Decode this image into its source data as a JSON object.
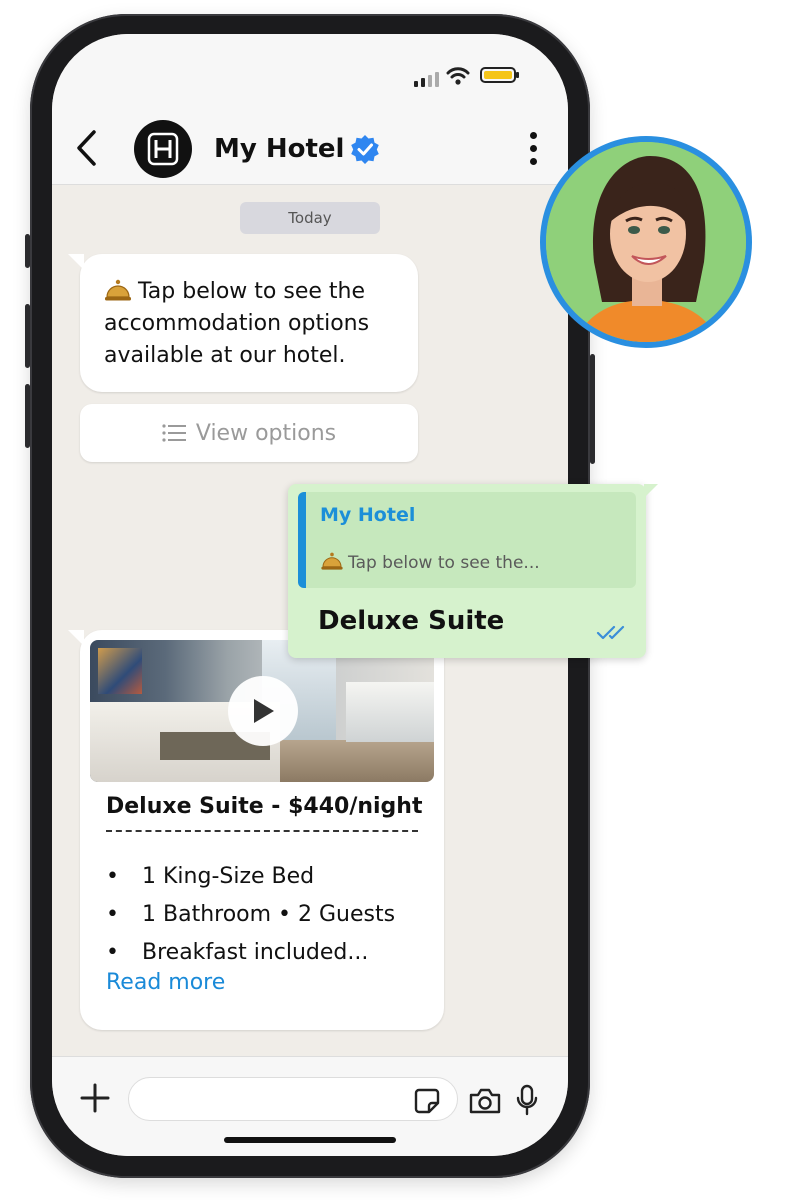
{
  "header": {
    "title": "My Hotel",
    "logo_letter": "H"
  },
  "chat": {
    "date_label": "Today",
    "incoming_message": "Tap below to see the accommodation options available at our hotel.",
    "view_options_label": "View options",
    "reply": {
      "quoted_sender": "My Hotel",
      "quoted_text": "Tap below to see the...",
      "text": "Deluxe Suite"
    },
    "card": {
      "title": "Deluxe Suite - $440/night",
      "divider": "--------------------------------------",
      "features": [
        "1 King-Size Bed",
        "1 Bathroom • 2 Guests",
        "Breakfast included..."
      ],
      "bullet": "•",
      "read_more": "Read more"
    }
  },
  "colors": {
    "accent_blue": "#1a8ad8",
    "verified_blue": "#2f86f0",
    "outgoing_bubble": "#d6f2cd",
    "chat_background": "#f0ede8",
    "battery_yellow": "#f5c518"
  },
  "icons": {
    "back": "chevron-left-icon",
    "verified": "verified-badge-icon",
    "menu": "more-vertical-icon",
    "bell": "bell-icon",
    "list": "list-icon",
    "play": "play-icon",
    "read_receipt": "double-check-icon",
    "plus": "plus-icon",
    "sticker": "sticker-icon",
    "camera": "camera-icon",
    "mic": "microphone-icon"
  }
}
